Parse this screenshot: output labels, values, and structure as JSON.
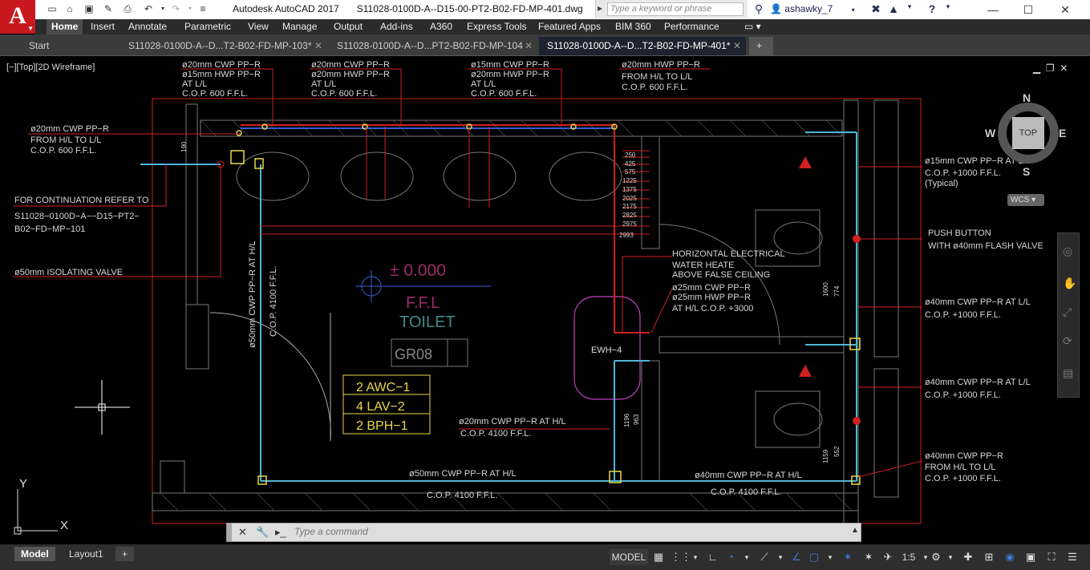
{
  "app": {
    "title": "Autodesk AutoCAD 2017",
    "file": "S11028-0100D-A--D15-00-PT2-B02-FD-MP-401.dwg",
    "logo": "A"
  },
  "search": {
    "placeholder": "Type a keyword or phrase"
  },
  "user": {
    "name": "ashawky_7"
  },
  "ribbon": {
    "tabs": [
      "Home",
      "Insert",
      "Annotate",
      "Parametric",
      "View",
      "Manage",
      "Output",
      "Add-ins",
      "A360",
      "Express Tools",
      "Featured Apps",
      "BIM 360",
      "Performance"
    ]
  },
  "doc_tabs": [
    "Start",
    "S11028-0100D-A--D...T2-B02-FD-MP-103*",
    "S11028-0100D-A--D...PT2-B02-FD-MP-104",
    "S11028-0100D-A--D...T2-B02-FD-MP-401*"
  ],
  "viewport": {
    "label": "[−][Top][2D Wireframe]"
  },
  "viewcube": {
    "n": "N",
    "s": "S",
    "e": "E",
    "w": "W",
    "top": "TOP",
    "wcs": "WCS"
  },
  "ucs": {
    "x": "X",
    "y": "Y"
  },
  "drawing": {
    "tl1": [
      "ø20mm  CWP  PP−R",
      "ø15mm  HWP  PP−R",
      "AT  L/L",
      "C.O.P.  600  F.F.L."
    ],
    "tl2": [
      "ø20mm  CWP  PP−R",
      "ø20mm  HWP  PP−R",
      "AT  L/L",
      "C.O.P.  600  F.F.L."
    ],
    "tl3": [
      "ø15mm  CWP  PP−R",
      "ø20mm  HWP  PP−R",
      "AT  L/L",
      "C.O.P.  600  F.F.L."
    ],
    "tl4": [
      "ø20mm  HWP  PP−R",
      "FROM  H/L  TO  L/L",
      "C.O.P.  600  F.F.L."
    ],
    "left1": [
      "ø20mm  CWP  PP−R",
      "FROM  H/L  TO  L/L",
      "C.O.P.  600  F.F.L."
    ],
    "cont": [
      "FOR  CONTINUATION  REFER  TO",
      "S11028−0100D−A−−D15−PT2−",
      "B02−FD−MP−101"
    ],
    "valve": "ø50mm  ISOLATING  VALVE",
    "dims": [
      "250",
      "425",
      "575",
      "1225",
      "1375",
      "2025",
      "2175",
      "2825",
      "2975",
      "2993"
    ],
    "level": "±  0.000",
    "ffl": "F.F.L",
    "room": "TOILET",
    "roomno": "GR08",
    "schedule": [
      "2  AWC−1",
      "4  LAV−2",
      "2  BPH−1"
    ],
    "ewh": "EWH−4",
    "heater": [
      "HORIZONTAL  ELECTRICAL",
      "WATER  HEATE",
      "ABOVE  FALSE  CEILING",
      "ø25mm  CWP  PP−R",
      "ø25mm  HWP  PP−R",
      "AT  H/L  C.O.P.  +3000"
    ],
    "vert1": "ø50mm  CWP  PP−R  AT  H/L",
    "vert2": "C.O.P.  4100  F.F.L.",
    "mid_cwp": [
      "ø20mm  CWP  PP−R  AT  H/L",
      "C.O.P.  4100  F.F.L."
    ],
    "bot1": [
      "ø50mm  CWP  PP−R  AT  H/L",
      "C.O.P.  4100  F.F.L."
    ],
    "bot2": [
      "ø40mm  CWP  PP−R  AT  H/L",
      "C.O.P.  4100  F.F.L."
    ],
    "r1": [
      "ø15mm  CWP  PP−R  AT  L/L",
      "C.O.P.  +1000  F.F.L.",
      "(Typical)"
    ],
    "r2": [
      "PUSH  BUTTON",
      "WITH  ø40mm  FLASH  VALVE"
    ],
    "r3": [
      "ø40mm  CWP  PP−R  AT  L/L",
      "C.O.P.  +1000  F.F.L."
    ],
    "r4": [
      "ø40mm  CWP  PP−R  AT  L/L",
      "C.O.P.  +1000  F.F.L."
    ],
    "r5": [
      "ø40mm  CWP  PP−R",
      "FROM  H/L  TO  L/L",
      "C.O.P.  +1000  F.F.L."
    ],
    "vdims": [
      "1600",
      "774",
      "1159",
      "552",
      "1196",
      "963",
      "190"
    ]
  },
  "command": {
    "placeholder": "Type  a  command"
  },
  "layouts": [
    "Model",
    "Layout1"
  ],
  "status": {
    "model": "MODEL",
    "scale": "1:5"
  },
  "colors": {
    "red": "#d02020",
    "cyan": "#4fb6d6",
    "yellow": "#e8d84a",
    "blue": "#3060d0",
    "magenta": "#c040c0",
    "wall": "#7a7a7a"
  }
}
